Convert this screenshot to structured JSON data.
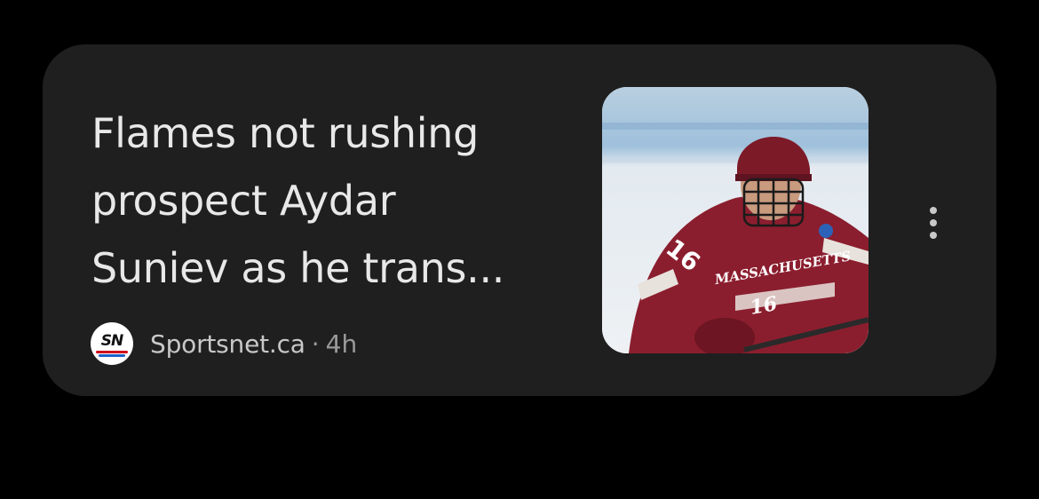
{
  "article": {
    "headline_lines": [
      "Flames not rushing",
      "prospect Aydar",
      "Suniev as he trans..."
    ],
    "source": {
      "logo_text": "SN",
      "name": "Sportsnet.ca",
      "separator": "·",
      "age": "4h"
    },
    "thumbnail": {
      "jersey_team_text": "MASSACHUSETTS",
      "jersey_number": "16"
    },
    "menu_icon": "more-vertical-icon"
  },
  "colors": {
    "background": "#000000",
    "card": "#1f1f1f",
    "headline": "#e8e8e8",
    "meta": "#9a9a9a",
    "jersey_maroon": "#8b1e2e"
  }
}
